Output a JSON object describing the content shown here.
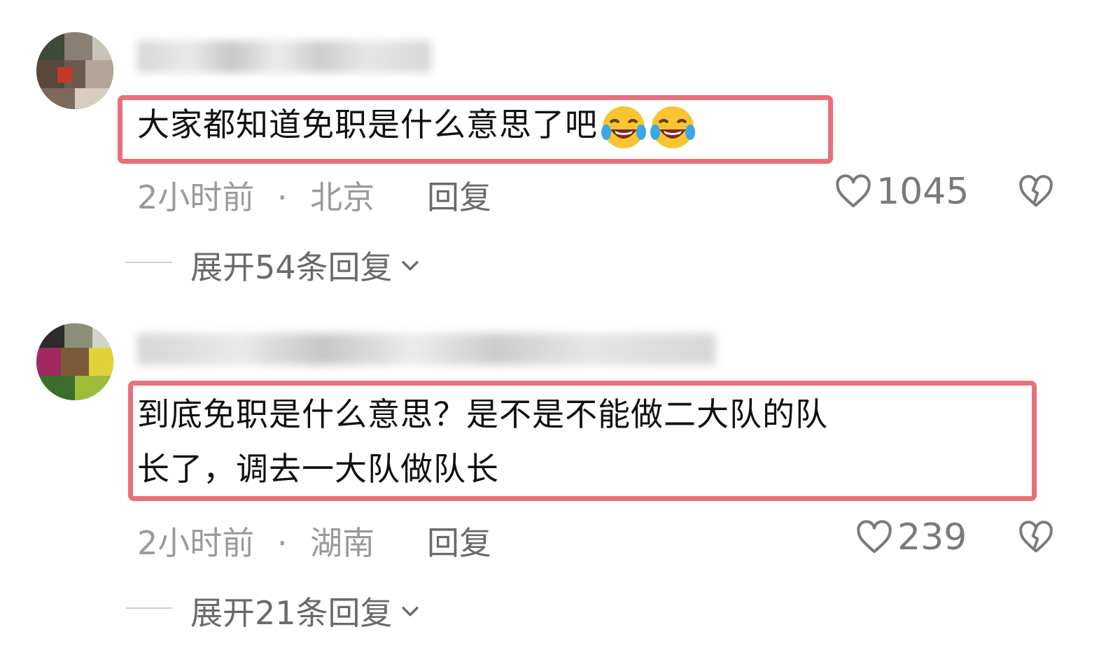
{
  "comments": [
    {
      "text": "大家都知道免职是什么意思了吧",
      "emoji_count": 2,
      "time": "2小时前",
      "location": "北京",
      "separator": "·",
      "reply_label": "回复",
      "likes": "1045",
      "expand_label": "展开54条回复"
    },
    {
      "text_line1": "到底免职是什么意思？是不是不能做二大队的队",
      "text_line2": "长了，调去一大队做队长",
      "time": "2小时前",
      "location": "湖南",
      "separator": "·",
      "reply_label": "回复",
      "likes": "239",
      "expand_label": "展开21条回复"
    }
  ],
  "colors": {
    "highlight": "#e8707a",
    "meta": "#9a9a9a",
    "action": "#6a6a6a"
  },
  "icons": [
    "heart-icon",
    "heart-broken-icon",
    "chevron-down-icon",
    "laughing-tears-emoji"
  ]
}
